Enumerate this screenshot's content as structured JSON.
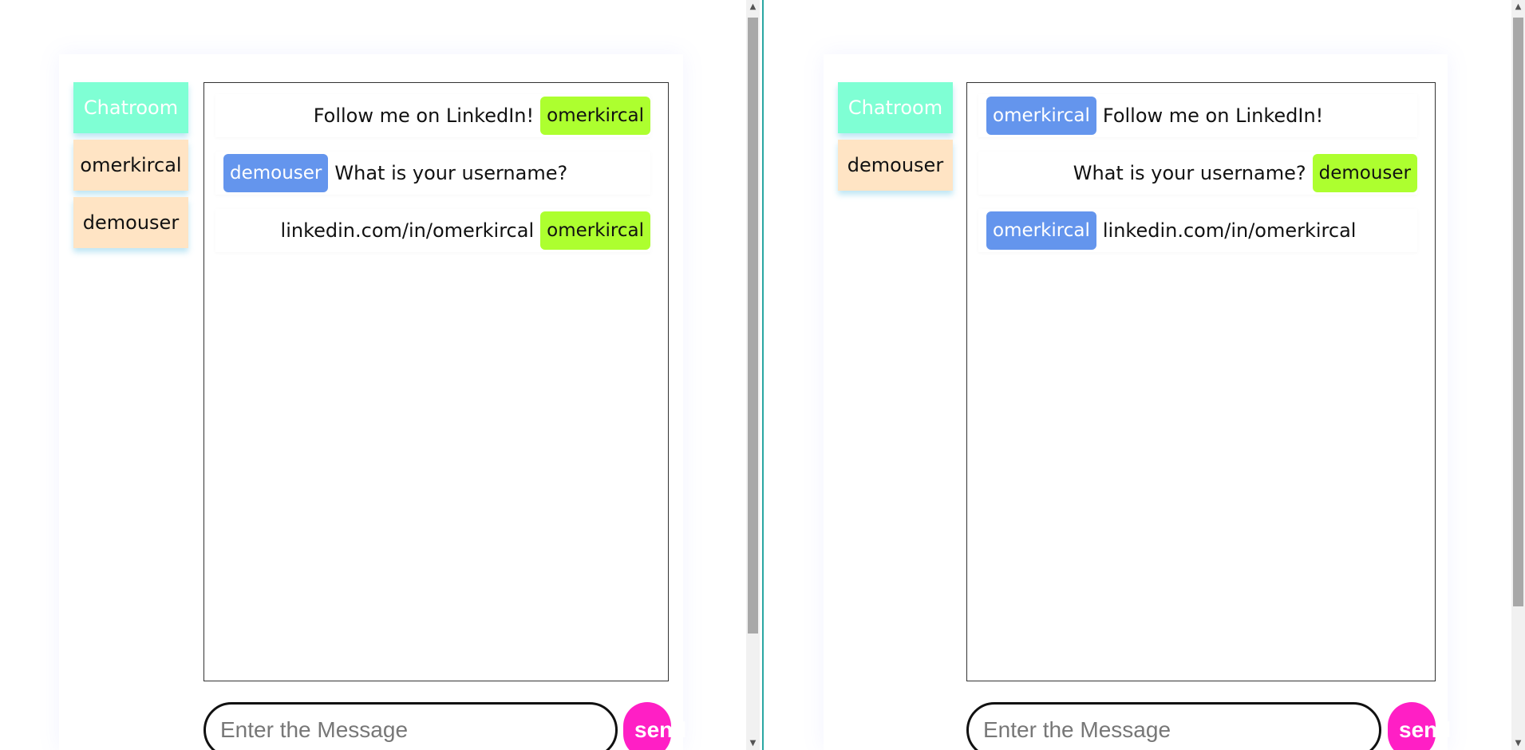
{
  "left": {
    "sidebar": [
      "Chatroom",
      "omerkircal",
      "demouser"
    ],
    "messages": [
      {
        "side": "mine",
        "user": "omerkircal",
        "text": "Follow me on LinkedIn!"
      },
      {
        "side": "theirs",
        "user": "demouser",
        "text": "What is your username?"
      },
      {
        "side": "mine",
        "user": "omerkircal",
        "text": "linkedin.com/in/omerkircal"
      }
    ],
    "input": {
      "placeholder": "Enter the Message",
      "value": ""
    },
    "send_label": "send"
  },
  "right": {
    "sidebar": [
      "Chatroom",
      "demouser"
    ],
    "messages": [
      {
        "side": "theirs",
        "user": "omerkircal",
        "text": "Follow me on LinkedIn!"
      },
      {
        "side": "mine",
        "user": "demouser",
        "text": "What is your username?"
      },
      {
        "side": "theirs",
        "user": "omerkircal",
        "text": "linkedin.com/in/omerkircal"
      }
    ],
    "input": {
      "placeholder": "Enter the Message",
      "value": ""
    },
    "send_label": "send"
  },
  "colors": {
    "chatroom_button": "#7fffd4",
    "user_button": "#ffe4c4",
    "own_tag": "#adff2f",
    "other_tag": "#6495ed",
    "send_button": "#ff1fc5"
  }
}
